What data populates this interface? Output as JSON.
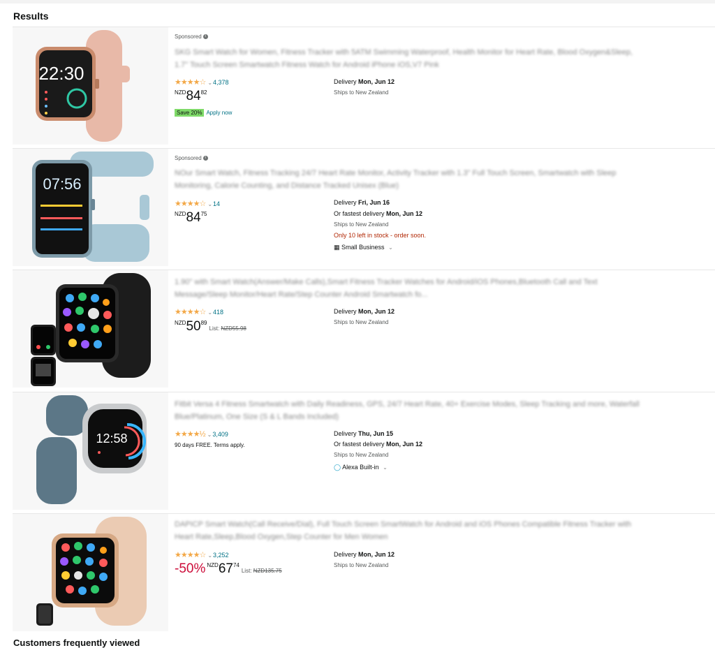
{
  "page": {
    "heading": "Results",
    "bottom_heading": "Customers frequently viewed"
  },
  "products": [
    {
      "sponsored": "Sponsored",
      "title": "SKG Smart Watch for Women, Fitness Tracker with 5ATM Swimming Waterproof, Health Monitor for Heart Rate, Blood Oxygen&Sleep, 1.7\" Touch Screen Smartwatch Fitness Watch for Android iPhone iOS,V7 Pink",
      "stars": "★★★★☆",
      "rating_count": "4,378",
      "currency": "NZD",
      "price_whole": "84",
      "price_fraction": "82",
      "save_badge": "Save 20%",
      "apply_link": "Apply now",
      "delivery_label": "Delivery",
      "delivery_date": "Mon, Jun 12",
      "ships_to": "Ships to New Zealand",
      "watch": {
        "screen_time": "22:30",
        "screen_bg": "#1a1a1a",
        "band": "#e8b9a8",
        "case": "#c98b6c"
      }
    },
    {
      "sponsored": "Sponsored",
      "title": "NOur Smart Watch, Fitness Tracking 24/7 Heart Rate Monitor, Activity Tracker with 1.3\" Full Touch Screen, Smartwatch with Sleep Monitoring, Calorie Counting, and Distance Tracked Unisex (Blue)",
      "stars": "★★★★☆",
      "rating_count": "14",
      "currency": "NZD",
      "price_whole": "84",
      "price_fraction": "75",
      "delivery_label": "Delivery",
      "delivery_date": "Fri, Jun 16",
      "fastest_label": "Or fastest delivery",
      "fastest_date": "Mon, Jun 12",
      "ships_to": "Ships to New Zealand",
      "stock_note": "Only 10 left in stock - order soon.",
      "badge": "Small Business",
      "watch": {
        "screen_time": "07:56",
        "screen_bg": "#111",
        "band": "#a9c8d6",
        "case": "#7d9aa8"
      }
    },
    {
      "title": "1.90\" with Smart Watch(Answer/Make Calls),Smart Fitness Tracker Watches for Android/iOS Phones,Bluetooth Call and Text Message/Sleep Monitor/Heart Rate/Step Counter Android Smartwatch fo...",
      "stars": "★★★★☆",
      "rating_count": "418",
      "currency": "NZD",
      "price_whole": "50",
      "price_fraction": "89",
      "list_label": "List:",
      "list_price": "NZD55.98",
      "delivery_label": "Delivery",
      "delivery_date": "Mon, Jun 12",
      "ships_to": "Ships to New Zealand",
      "watch": {
        "screen_time": "",
        "screen_bg": "#111",
        "band": "#1c1c1c",
        "case": "#2a2a2a"
      }
    },
    {
      "title": "Fitbit Versa 4 Fitness Smartwatch with Daily Readiness, GPS, 24/7 Heart Rate, 40+ Exercise Modes, Sleep Tracking and more, Waterfall Blue/Platinum, One Size (S & L Bands Included)",
      "stars": "★★★★½",
      "rating_count": "3,409",
      "note": "90 days FREE. Terms apply.",
      "delivery_label": "Delivery",
      "delivery_date": "Thu, Jun 15",
      "fastest_label": "Or fastest delivery",
      "fastest_date": "Mon, Jun 12",
      "ships_to": "Ships to New Zealand",
      "badge": "Alexa Built-in",
      "watch": {
        "screen_time": "12:58",
        "screen_bg": "#0d0d0d",
        "band": "#5c7787",
        "case": "#c9cbcd"
      }
    },
    {
      "title": "DAPICP Smart Watch(Call Receive/Dial), Full Touch Screen SmartWatch for Android and iOS Phones Compatible Fitness Tracker with Heart Rate,Sleep,Blood Oxygen,Step Counter for Men Women",
      "stars": "★★★★☆",
      "rating_count": "3,252",
      "discount": "-50%",
      "currency": "NZD",
      "price_whole": "67",
      "price_fraction": "74",
      "list_label": "List:",
      "list_price": "NZD135.75",
      "delivery_label": "Delivery",
      "delivery_date": "Mon, Jun 12",
      "ships_to": "Ships to New Zealand",
      "watch": {
        "screen_time": "",
        "screen_bg": "#111",
        "band": "#ebcbb3",
        "case": "#d6a884"
      }
    }
  ]
}
